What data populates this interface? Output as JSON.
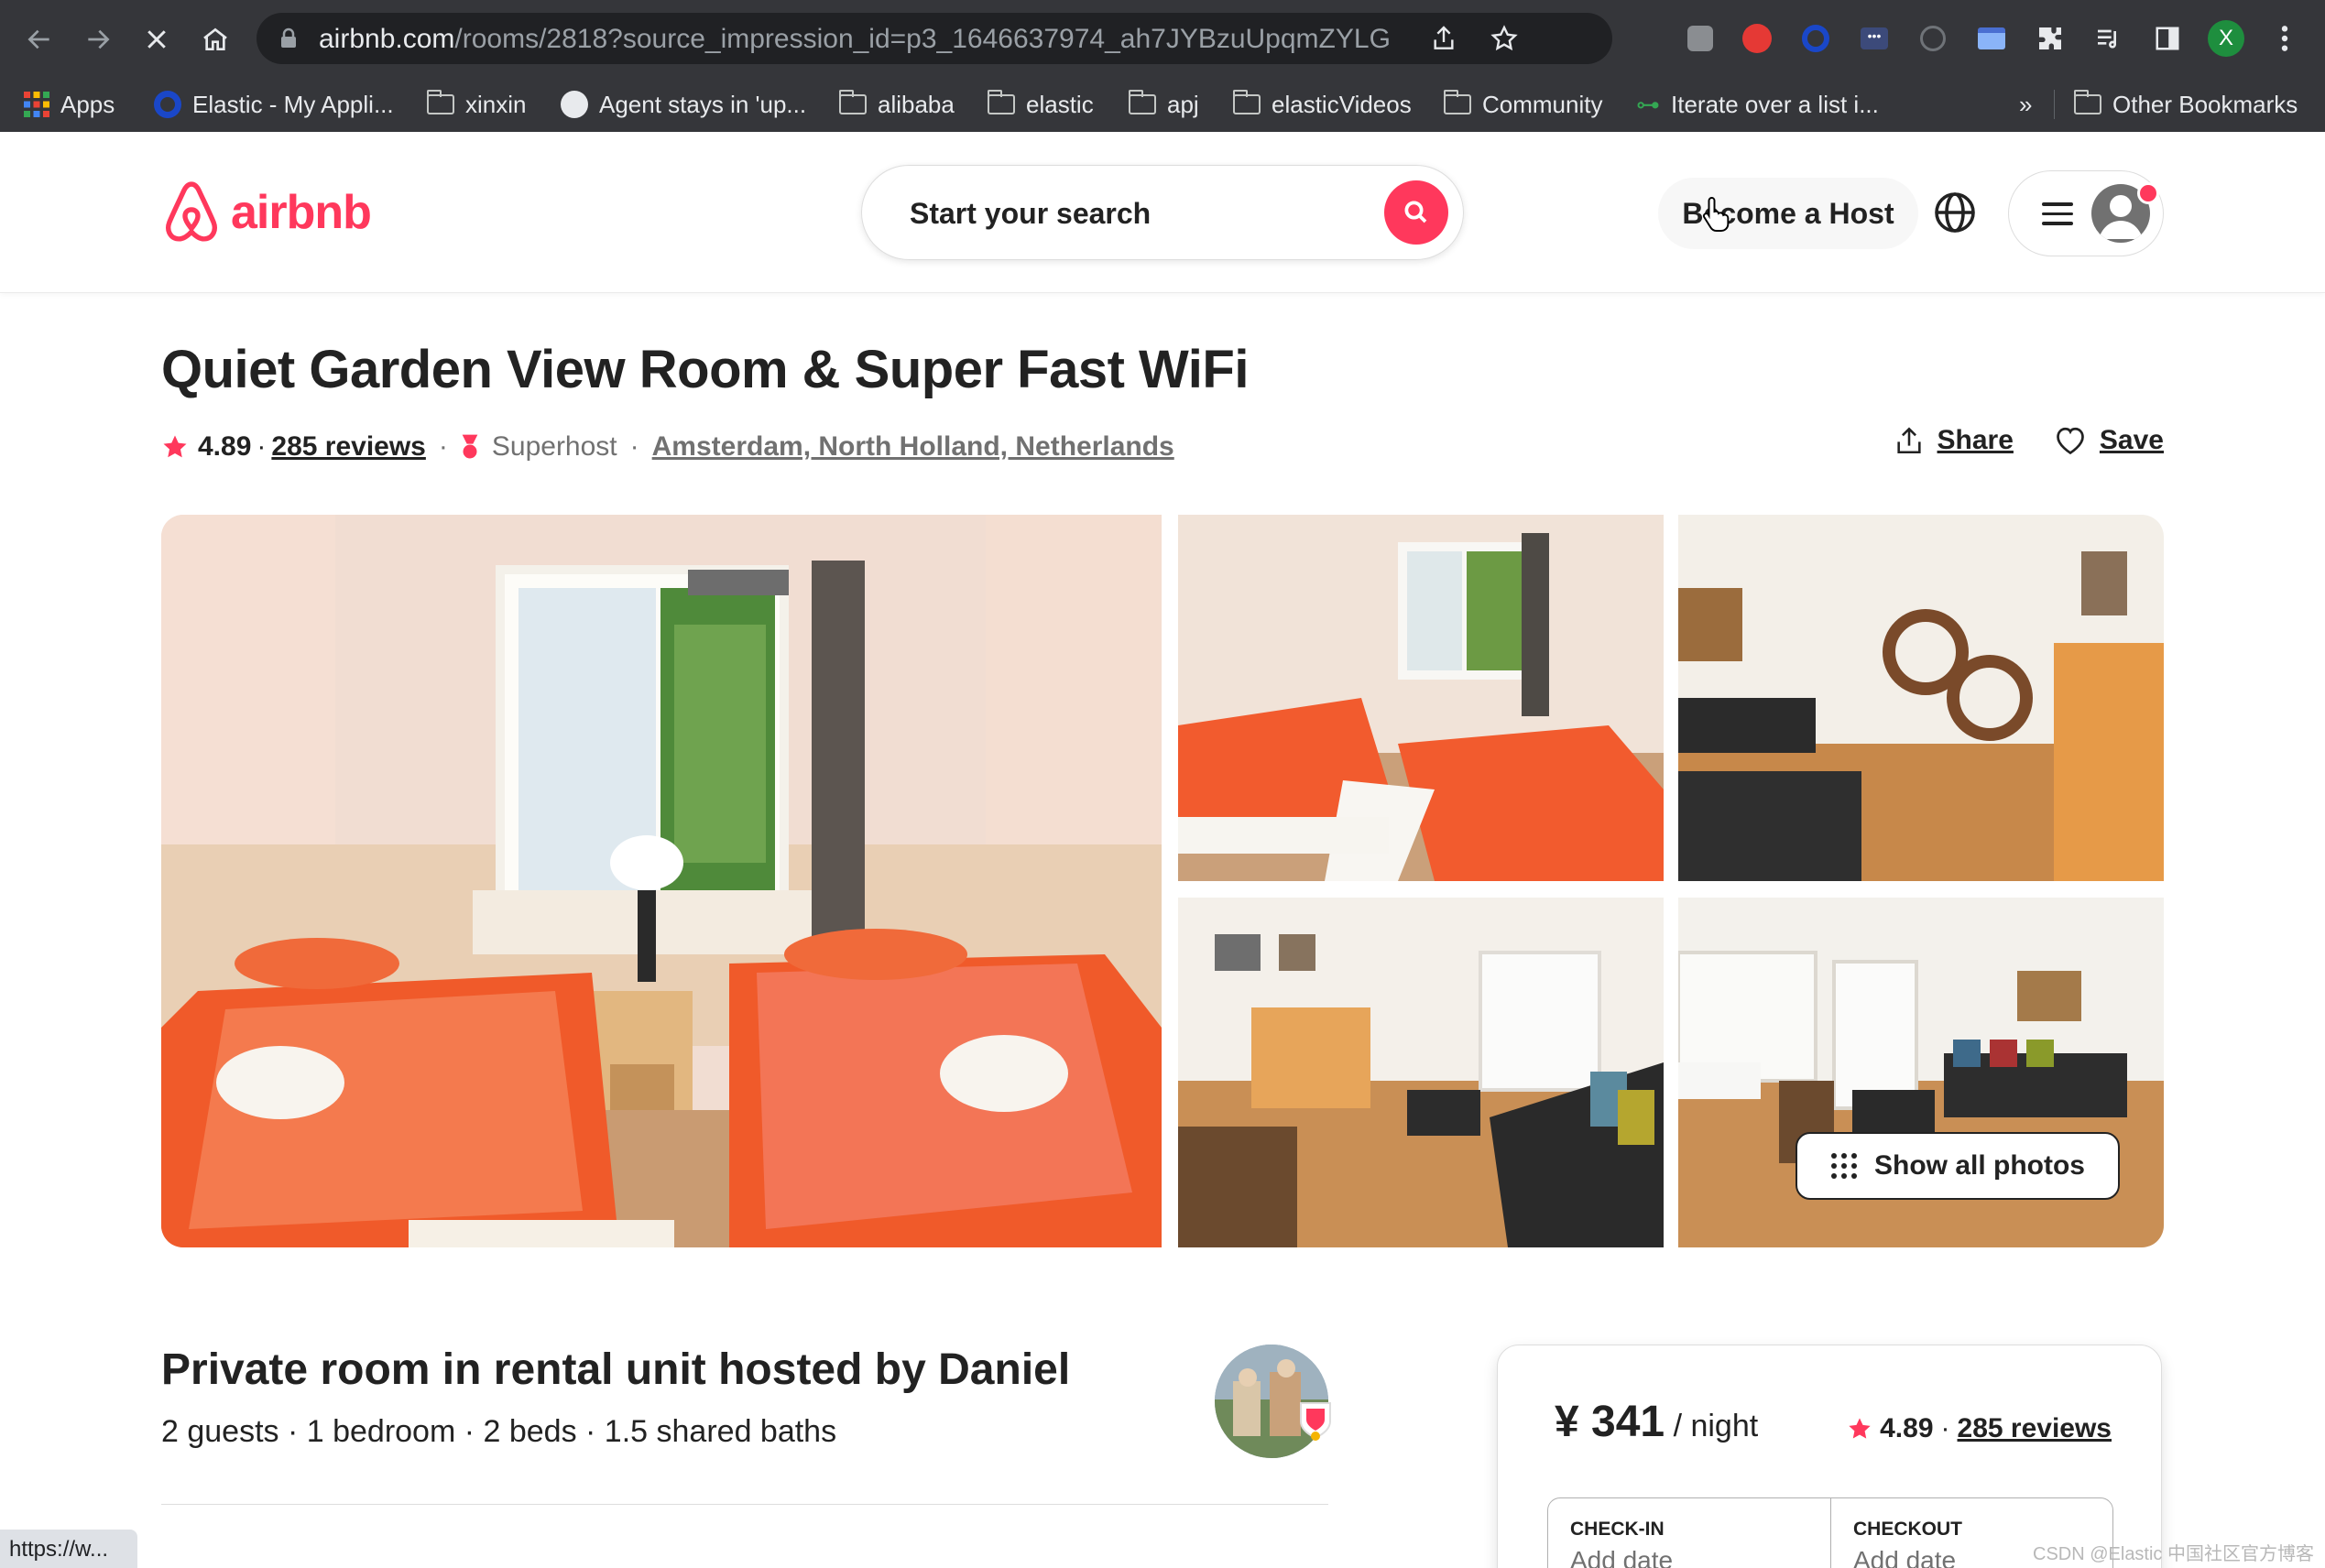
{
  "browser": {
    "url_host": "airbnb.com",
    "url_path": "/rooms/2818?source_impression_id=p3_1646637974_ah7JYBzuUpqmZYLG",
    "status_url": "https://w...",
    "bookmarks": [
      {
        "label": "Apps",
        "icon": "apps-grid-icon"
      },
      {
        "label": "Elastic - My Appli...",
        "icon": "elastic-icon"
      },
      {
        "label": "xinxin",
        "icon": "folder-icon"
      },
      {
        "label": "Agent stays in 'up...",
        "icon": "github-icon"
      },
      {
        "label": "alibaba",
        "icon": "folder-icon"
      },
      {
        "label": "elastic",
        "icon": "folder-icon"
      },
      {
        "label": "apj",
        "icon": "folder-icon"
      },
      {
        "label": "elasticVideos",
        "icon": "folder-icon"
      },
      {
        "label": "Community",
        "icon": "folder-icon"
      },
      {
        "label": "Iterate over a list i...",
        "icon": "link-icon"
      }
    ],
    "overflow_label": "»",
    "other_bookmarks": "Other Bookmarks",
    "profile_initial": "X"
  },
  "header": {
    "logo_text": "airbnb",
    "search_placeholder": "Start your search",
    "host_label": "Become a Host"
  },
  "listing": {
    "title": "Quiet Garden View Room & Super Fast WiFi",
    "rating": "4.89",
    "rating_sep": "·",
    "reviews": "285 reviews",
    "dot": "·",
    "superhost": "Superhost",
    "location": "Amsterdam, North Holland, Netherlands",
    "share_label": "Share",
    "save_label": "Save",
    "show_photos_label": "Show all photos"
  },
  "details": {
    "room_title": "Private room in rental unit hosted by Daniel",
    "room_sub": "2 guests · 1 bedroom · 2 beds · 1.5 shared baths"
  },
  "booking": {
    "price": "¥ 341",
    "per": " / night",
    "rating": "4.89",
    "rating_sep": "·",
    "reviews": "285 reviews",
    "checkin_label": "CHECK-IN",
    "checkin_value": "Add date",
    "checkout_label": "CHECKOUT",
    "checkout_value": "Add date"
  },
  "watermark": "CSDN @Elastic 中国社区官方博客",
  "colors": {
    "brand": "#ff385c",
    "chrome": "#35363a",
    "text": "#222222",
    "muted": "#717171"
  }
}
